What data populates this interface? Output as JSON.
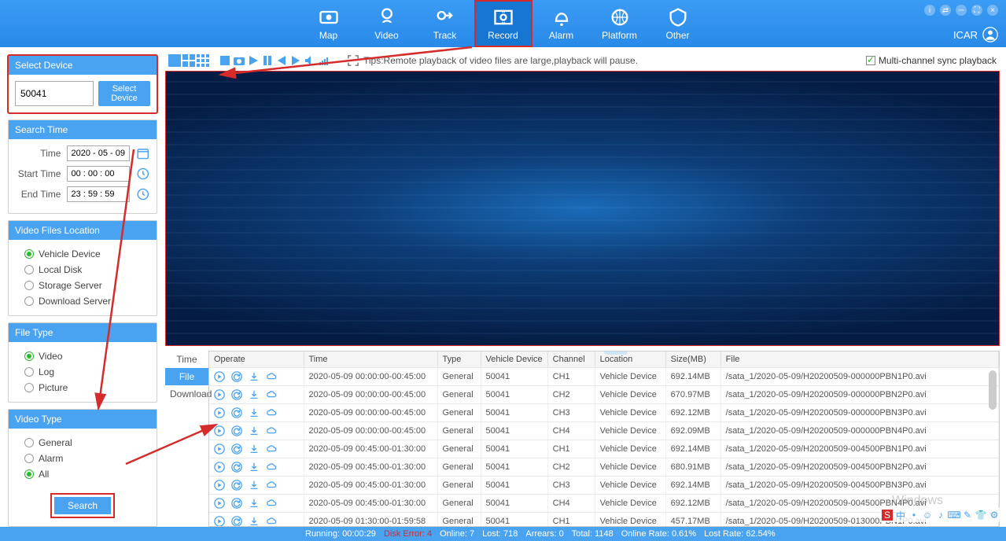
{
  "nav": [
    {
      "id": "map",
      "label": "Map"
    },
    {
      "id": "video",
      "label": "Video"
    },
    {
      "id": "track",
      "label": "Track"
    },
    {
      "id": "record",
      "label": "Record",
      "active": true,
      "highlight": true
    },
    {
      "id": "alarm",
      "label": "Alarm"
    },
    {
      "id": "platform",
      "label": "Platform"
    },
    {
      "id": "other",
      "label": "Other"
    }
  ],
  "user_label": "ICAR",
  "select_device": {
    "header": "Select Device",
    "value": "50041",
    "button": "Select Device"
  },
  "search_time": {
    "header": "Search Time",
    "time_label": "Time",
    "time_value": "2020 - 05 - 09",
    "start_label": "Start Time",
    "start_value": "00 : 00 : 00",
    "end_label": "End Time",
    "end_value": "23 : 59 : 59"
  },
  "video_files": {
    "header": "Video Files Location",
    "options": [
      {
        "label": "Vehicle Device",
        "selected": true
      },
      {
        "label": "Local Disk"
      },
      {
        "label": "Storage Server"
      },
      {
        "label": "Download Server"
      }
    ]
  },
  "file_type": {
    "header": "File Type",
    "options": [
      {
        "label": "Video",
        "selected": true
      },
      {
        "label": "Log"
      },
      {
        "label": "Picture"
      }
    ]
  },
  "video_type": {
    "header": "Video Type",
    "options": [
      {
        "label": "General"
      },
      {
        "label": "Alarm"
      },
      {
        "label": "All",
        "selected": true
      }
    ]
  },
  "search_label": "Search",
  "tips": "Tips:Remote playback of video files are large,playback will pause.",
  "sync_label": "Multi-channel sync playback",
  "left_tabs": [
    "Time",
    "File",
    "Download"
  ],
  "columns": [
    "Operate",
    "Time",
    "Type",
    "Vehicle Device",
    "Channel",
    "Location",
    "Size(MB)",
    "File"
  ],
  "rows": [
    {
      "time": "2020-05-09 00:00:00-00:45:00",
      "type": "General",
      "device": "50041",
      "ch": "CH1",
      "loc": "Vehicle Device",
      "size": "692.14MB",
      "file": "/sata_1/2020-05-09/H20200509-000000PBN1P0.avi"
    },
    {
      "time": "2020-05-09 00:00:00-00:45:00",
      "type": "General",
      "device": "50041",
      "ch": "CH2",
      "loc": "Vehicle Device",
      "size": "670.97MB",
      "file": "/sata_1/2020-05-09/H20200509-000000PBN2P0.avi"
    },
    {
      "time": "2020-05-09 00:00:00-00:45:00",
      "type": "General",
      "device": "50041",
      "ch": "CH3",
      "loc": "Vehicle Device",
      "size": "692.12MB",
      "file": "/sata_1/2020-05-09/H20200509-000000PBN3P0.avi"
    },
    {
      "time": "2020-05-09 00:00:00-00:45:00",
      "type": "General",
      "device": "50041",
      "ch": "CH4",
      "loc": "Vehicle Device",
      "size": "692.09MB",
      "file": "/sata_1/2020-05-09/H20200509-000000PBN4P0.avi"
    },
    {
      "time": "2020-05-09 00:45:00-01:30:00",
      "type": "General",
      "device": "50041",
      "ch": "CH1",
      "loc": "Vehicle Device",
      "size": "692.14MB",
      "file": "/sata_1/2020-05-09/H20200509-004500PBN1P0.avi"
    },
    {
      "time": "2020-05-09 00:45:00-01:30:00",
      "type": "General",
      "device": "50041",
      "ch": "CH2",
      "loc": "Vehicle Device",
      "size": "680.91MB",
      "file": "/sata_1/2020-05-09/H20200509-004500PBN2P0.avi"
    },
    {
      "time": "2020-05-09 00:45:00-01:30:00",
      "type": "General",
      "device": "50041",
      "ch": "CH3",
      "loc": "Vehicle Device",
      "size": "692.14MB",
      "file": "/sata_1/2020-05-09/H20200509-004500PBN3P0.avi"
    },
    {
      "time": "2020-05-09 00:45:00-01:30:00",
      "type": "General",
      "device": "50041",
      "ch": "CH4",
      "loc": "Vehicle Device",
      "size": "692.12MB",
      "file": "/sata_1/2020-05-09/H20200509-004500PBN4P0.avi"
    },
    {
      "time": "2020-05-09 01:30:00-01:59:58",
      "type": "General",
      "device": "50041",
      "ch": "CH1",
      "loc": "Vehicle Device",
      "size": "457.17MB",
      "file": "/sata_1/2020-05-09/H20200509-013000PBN1P0.avi"
    }
  ],
  "status": {
    "running_label": "Running:",
    "running_value": "00:00:29",
    "disk_label": "Disk Error:",
    "disk_value": "4",
    "online_label": "Online:",
    "online_value": "7",
    "lost_label": "Lost:",
    "lost_value": "718",
    "arrears_label": "Arrears:",
    "arrears_value": "0",
    "total_label": "Total:",
    "total_value": "1148",
    "online_rate_label": "Online Rate:",
    "online_rate_value": "0.61%",
    "lost_rate_label": "Lost Rate:",
    "lost_rate_value": "62.54%"
  },
  "watermark": "Windows"
}
